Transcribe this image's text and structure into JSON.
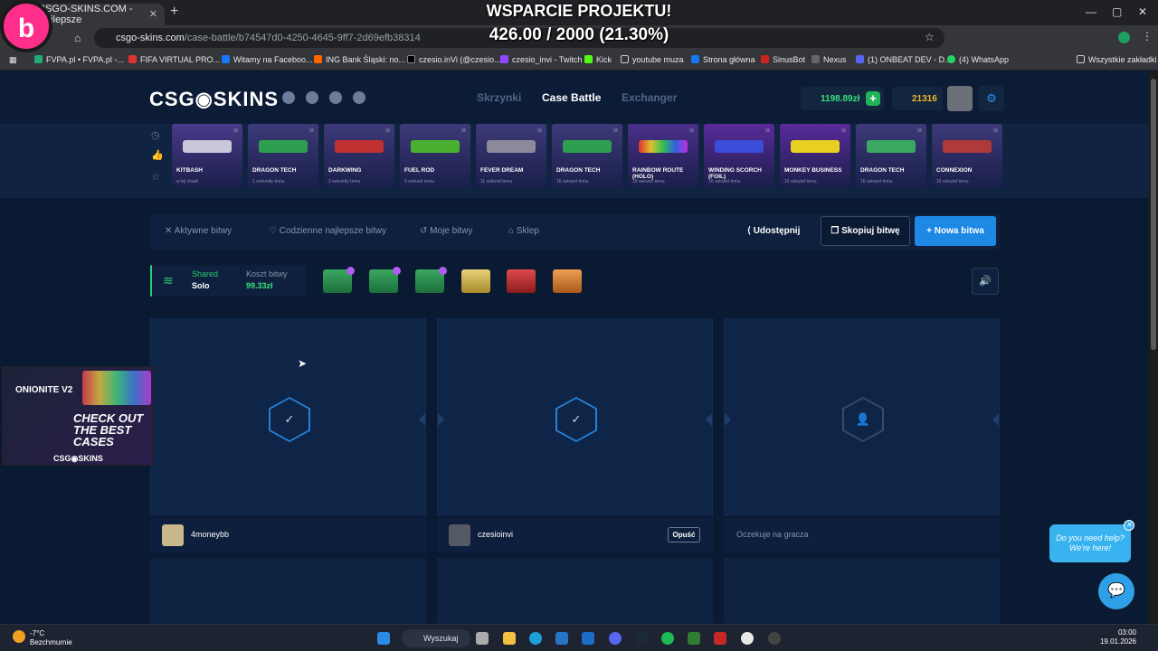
{
  "browser": {
    "tab_title": "CSGO-SKINS.COM - Najlepsze",
    "url_host": "csgo-skins.com",
    "url_path": "/case-battle/b74547d0-4250-4645-9ff7-2d69efb38314",
    "bookmarks": [
      "FVPA.pl • FVPA.pl -...",
      "FIFA VIRTUAL PRO...",
      "Witamy na Faceboo...",
      "ING Bank Śląski: no...",
      "czesio.inVi (@czesio...",
      "czesio_invi - Twitch",
      "Kick",
      "youtube muza",
      "Strona główna",
      "SinusBot",
      "Nexus",
      "(1) ONBEAT DEV - D...",
      "(4) WhatsApp",
      "Wszystkie zakładki"
    ]
  },
  "overlay": {
    "title": "WSPARCIE PROJEKTU!",
    "progress_text": "426.00 / 2000 (21.30%)",
    "progress": 0.213
  },
  "header": {
    "logo": "CSG◉SKINS",
    "nav": [
      "Skrzynki",
      "Case Battle",
      "Exchanger"
    ],
    "active_nav": "Case Battle",
    "balance": "1198.89zł",
    "coins": "21316"
  },
  "live_drops": [
    {
      "name": "KITBASH",
      "sub": "w tej chwili",
      "color": "#4a3a8a"
    },
    {
      "name": "DRAGON TECH",
      "sub": "1 sekundę temu",
      "color": "#3e3a7a"
    },
    {
      "name": "DARKWING",
      "sub": "3 sekundy temu",
      "color": "#3e3a7a"
    },
    {
      "name": "FUEL ROD",
      "sub": "9 sekund temu",
      "color": "#3e3a7a"
    },
    {
      "name": "FEVER DREAM",
      "sub": "11 sekund temu",
      "color": "#3e3a7a"
    },
    {
      "name": "DRAGON TECH",
      "sub": "16 sekund temu",
      "color": "#3e3a7a"
    },
    {
      "name": "RAINBOW ROUTE (HOLO)",
      "sub": "16 sekund temu",
      "color": "#4a2f8a"
    },
    {
      "name": "WINDING SCORCH (FOIL)",
      "sub": "16 sekund temu",
      "color": "#5a2a9a"
    },
    {
      "name": "MONKEY BUSINESS",
      "sub": "16 sekund temu",
      "color": "#5a2a9a"
    },
    {
      "name": "DRAGON TECH",
      "sub": "16 sekund temu",
      "color": "#3e3a7a"
    },
    {
      "name": "CONNEXION",
      "sub": "16 sekund temu",
      "color": "#3e3a7a"
    }
  ],
  "toolbar": {
    "active": "Aktywne bitwy",
    "daily": "Codzienne najlepsze bitwy",
    "mine": "Moje bitwy",
    "shop": "Sklep",
    "share": "Udostępnij",
    "copy": "Skopiuj bitwę",
    "new": "Nowa bitwa"
  },
  "battle_info": {
    "mode": "Shared",
    "type": "Solo",
    "cost_label": "Koszt bitwy",
    "cost": "99.33zł"
  },
  "players": [
    {
      "name": "4moneybb",
      "ready": true
    },
    {
      "name": "czesioinvi",
      "ready": true,
      "leave": "Opuść"
    },
    {
      "name": "Oczekuje na gracza",
      "ready": false
    }
  ],
  "ad": {
    "product": "ONIONITE V2",
    "headline": "CHECK OUT THE BEST CASES",
    "brand": "CSG◉SKINS"
  },
  "help": {
    "text": "Do you need help? We're here!"
  },
  "taskbar": {
    "weather_temp": "-7°C",
    "weather_desc": "Bezchmurnie",
    "search": "Wyszukaj",
    "time": "03:00",
    "date": "19.01.2026"
  }
}
